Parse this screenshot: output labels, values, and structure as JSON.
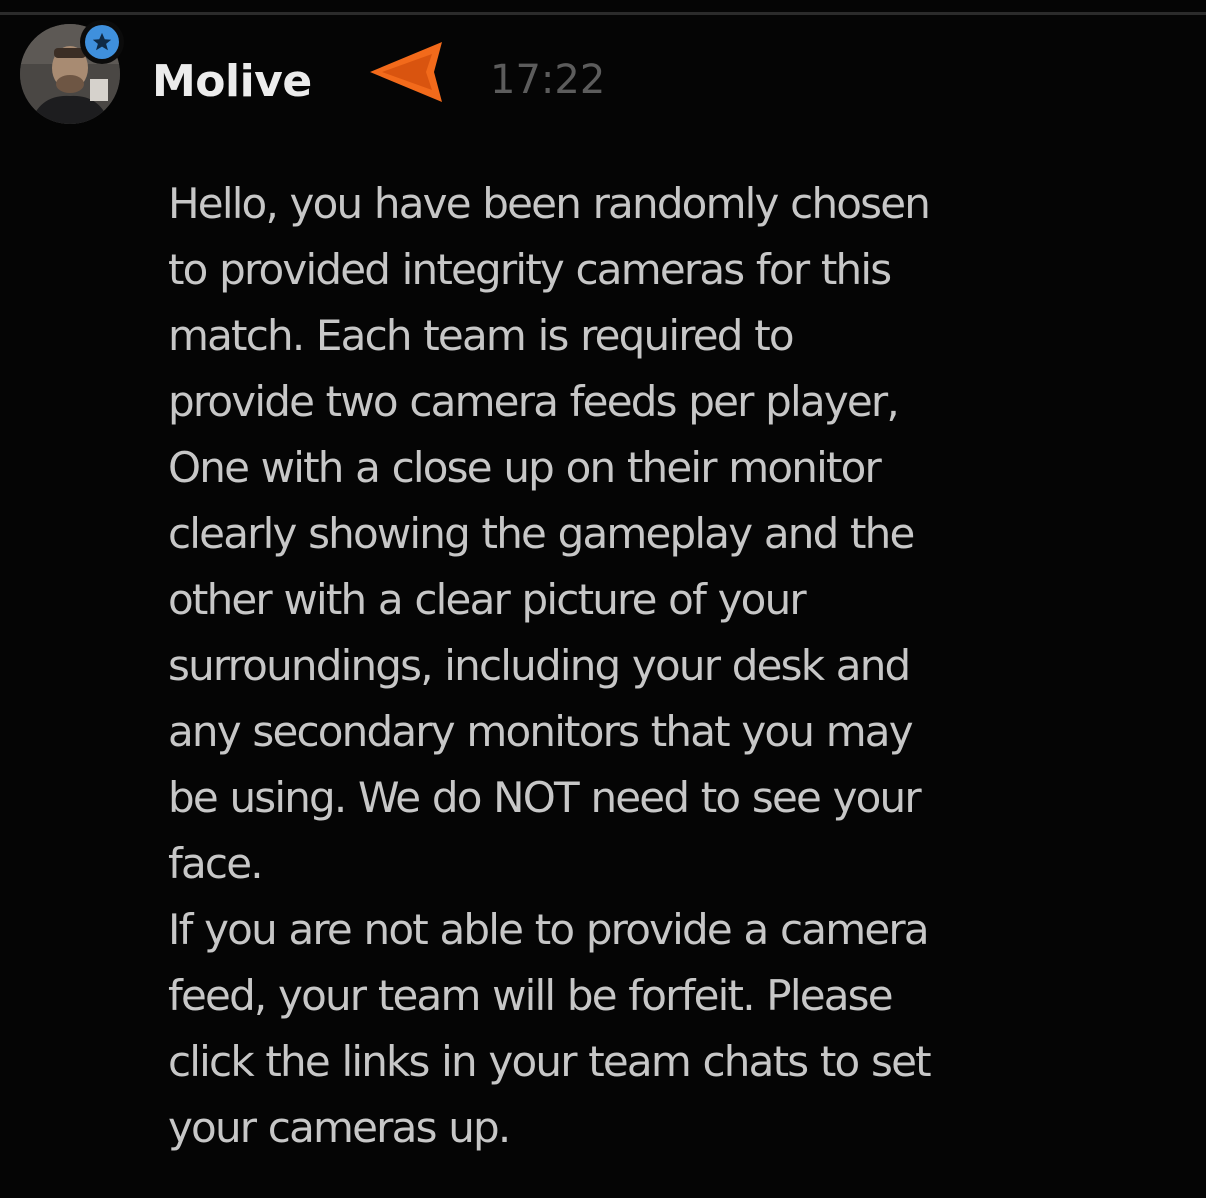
{
  "message": {
    "author": {
      "username": "Molive",
      "avatar_icon": "user-photo-avatar",
      "badge_icon": "star-badge-icon",
      "rank_icon": "orange-chevron-icon"
    },
    "timestamp": "17:22",
    "body_lines": [
      "Hello, you have been randomly chosen",
      "to provided integrity cameras for this",
      "match. Each team is required to",
      "provide two camera feeds per player,",
      "One with a close up on their monitor",
      "clearly showing the gameplay and the",
      "other with a clear picture of your",
      "surroundings, including your desk and",
      "any secondary monitors that you may",
      "be using. We do NOT need to see your",
      "face.",
      "If you are not able to provide a camera",
      "feed, your team will be forfeit. Please",
      "click the links in your team chats to set",
      "your cameras up."
    ]
  },
  "colors": {
    "background": "#050505",
    "username": "#ececec",
    "timestamp": "#5c5c5c",
    "body_text": "#c7c7c7",
    "badge": "#3f90dd",
    "rank_accent": "#f26a1b"
  }
}
